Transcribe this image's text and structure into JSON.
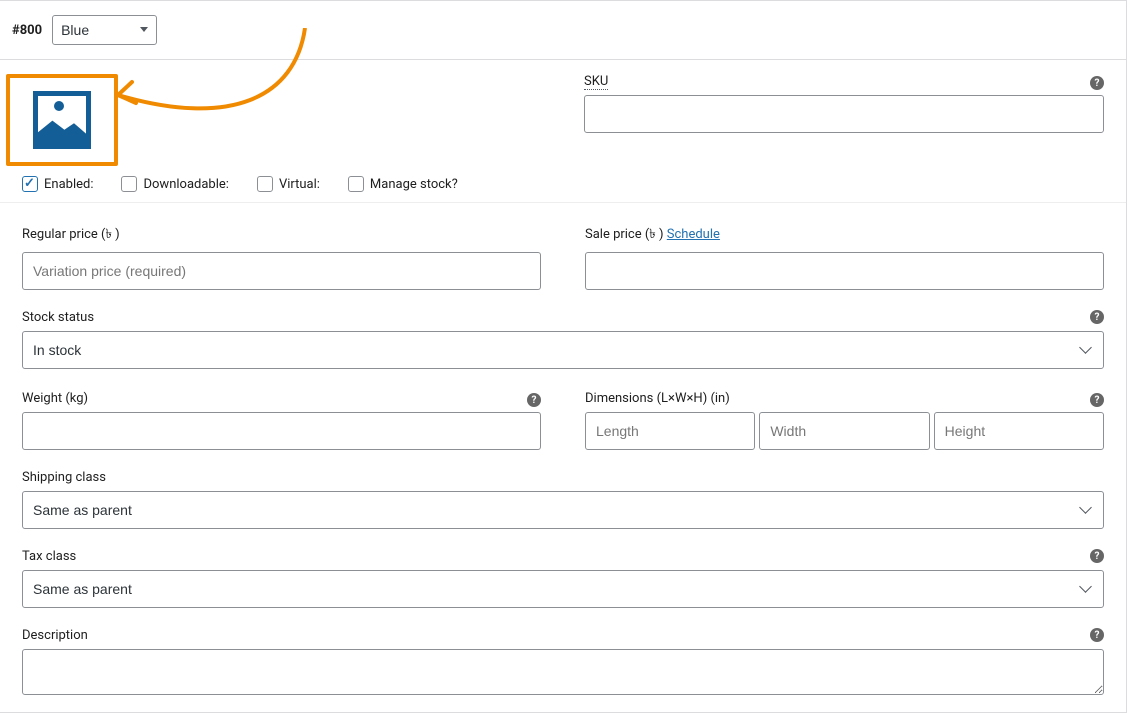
{
  "header": {
    "variation_id": "#800",
    "attribute_selected": "Blue"
  },
  "top": {
    "sku_label": "SKU"
  },
  "checkboxes": {
    "enabled": "Enabled:",
    "downloadable": "Downloadable:",
    "virtual": "Virtual:",
    "manage_stock": "Manage stock?"
  },
  "prices": {
    "regular_label": "Regular price (৳ )",
    "regular_placeholder": "Variation price (required)",
    "sale_label": "Sale price (৳ ) ",
    "schedule": "Schedule"
  },
  "stock": {
    "label": "Stock status",
    "selected": "In stock"
  },
  "weight": {
    "label": "Weight (kg)"
  },
  "dimensions": {
    "label": "Dimensions (L×W×H) (in)",
    "length_ph": "Length",
    "width_ph": "Width",
    "height_ph": "Height"
  },
  "shipping": {
    "label": "Shipping class",
    "selected": "Same as parent"
  },
  "tax": {
    "label": "Tax class",
    "selected": "Same as parent"
  },
  "description": {
    "label": "Description"
  }
}
